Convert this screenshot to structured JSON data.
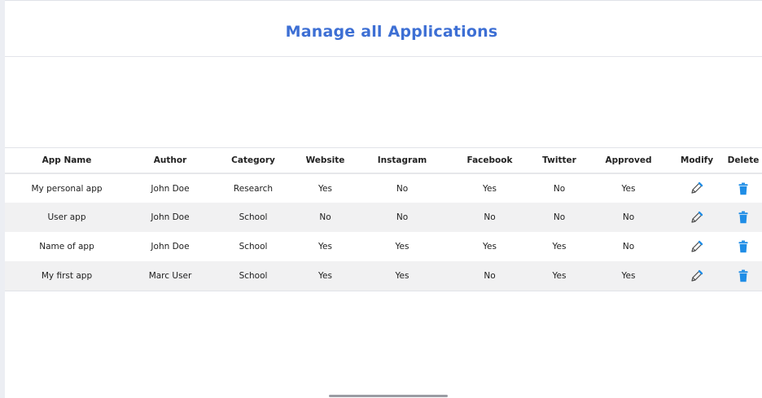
{
  "page": {
    "title": "Manage all Applications"
  },
  "table": {
    "headers": {
      "app_name": "App Name",
      "author": "Author",
      "category": "Category",
      "website": "Website",
      "instagram": "Instagram",
      "facebook": "Facebook",
      "twitter": "Twitter",
      "approved": "Approved",
      "modify": "Modify",
      "delete": "Delete"
    },
    "rows": [
      {
        "app_name": "My personal app",
        "author": "John Doe",
        "category": "Research",
        "website": "Yes",
        "instagram": "No",
        "facebook": "Yes",
        "twitter": "No",
        "approved": "Yes"
      },
      {
        "app_name": "User app",
        "author": "John Doe",
        "category": "School",
        "website": "No",
        "instagram": "No",
        "facebook": "No",
        "twitter": "No",
        "approved": "No"
      },
      {
        "app_name": "Name of app",
        "author": "John Doe",
        "category": "School",
        "website": "Yes",
        "instagram": "Yes",
        "facebook": "Yes",
        "twitter": "Yes",
        "approved": "No"
      },
      {
        "app_name": "My first app",
        "author": "Marc User",
        "category": "School",
        "website": "Yes",
        "instagram": "Yes",
        "facebook": "No",
        "twitter": "Yes",
        "approved": "Yes"
      }
    ],
    "row_icons": {
      "modify": "pencil-icon",
      "delete": "trash-icon"
    }
  },
  "colors": {
    "accent": "#3d6fd4",
    "delete_icon": "#1f8de6",
    "row_alt": "#f1f1f2"
  }
}
